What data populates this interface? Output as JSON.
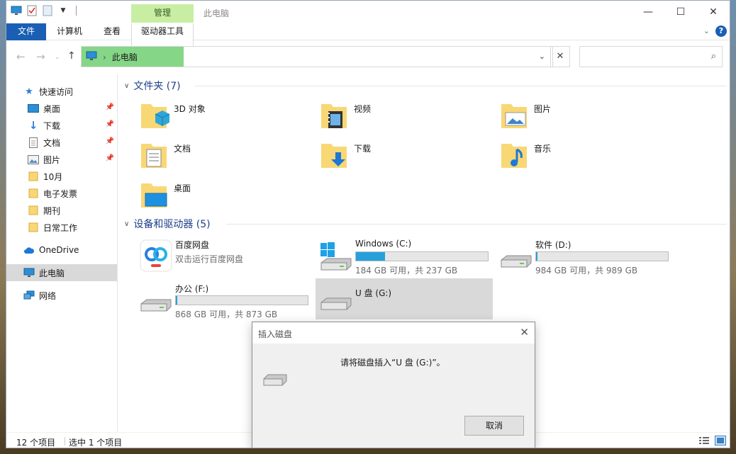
{
  "window": {
    "title": "此电脑",
    "context_tab": "管理",
    "controls": {
      "minimize": "—",
      "maximize": "☐",
      "close": "✕"
    }
  },
  "ribbon": {
    "tabs": [
      "文件",
      "计算机",
      "查看",
      "驱动器工具"
    ],
    "collapse_icon": "chevron-down-icon",
    "help_label": "?"
  },
  "address": {
    "breadcrumb": "此电脑",
    "separator": "›",
    "search_placeholder": ""
  },
  "sidebar": {
    "quick_access": "快速访问",
    "pinned": [
      {
        "label": "桌面",
        "icon": "desktop-icon"
      },
      {
        "label": "下载",
        "icon": "download-icon"
      },
      {
        "label": "文档",
        "icon": "document-icon"
      },
      {
        "label": "图片",
        "icon": "picture-icon"
      }
    ],
    "folders": [
      "10月",
      "电子发票",
      "期刊",
      "日常工作"
    ],
    "onedrive": "OneDrive",
    "this_pc": "此电脑",
    "network": "网络"
  },
  "folders_group": {
    "title": "文件夹 (7)",
    "items": [
      {
        "label": "3D 对象",
        "icon": "3d-objects-folder-icon"
      },
      {
        "label": "视频",
        "icon": "videos-folder-icon"
      },
      {
        "label": "图片",
        "icon": "pictures-folder-icon"
      },
      {
        "label": "文档",
        "icon": "documents-folder-icon"
      },
      {
        "label": "下载",
        "icon": "downloads-folder-icon"
      },
      {
        "label": "音乐",
        "icon": "music-folder-icon"
      },
      {
        "label": "桌面",
        "icon": "desktop-folder-icon"
      }
    ]
  },
  "devices_group": {
    "title": "设备和驱动器 (5)",
    "baidu": {
      "name": "百度网盘",
      "subtitle": "双击运行百度网盘"
    },
    "drives": [
      {
        "name": "Windows  (C:)",
        "size": "184 GB 可用，共 237 GB",
        "used_fraction": 0.22
      },
      {
        "name": "软件 (D:)",
        "size": "984 GB 可用，共 989 GB",
        "used_fraction": 0.005
      },
      {
        "name": "办公 (F:)",
        "size": "868 GB 可用，共 873 GB",
        "used_fraction": 0.006
      }
    ],
    "usb": {
      "name": "U 盘 (G:)"
    }
  },
  "status": {
    "count": "12 个项目",
    "selection": "选中 1 个项目"
  },
  "dialog": {
    "title": "插入磁盘",
    "message": "请将磁盘插入“U 盘 (G:)”。",
    "cancel": "取消"
  },
  "colors": {
    "accent": "#1a5fb4",
    "manage_tab": "#c8eea4",
    "address_highlight": "#85d687",
    "drive_bar": "#26a0da",
    "selection": "#d9d9d9"
  }
}
